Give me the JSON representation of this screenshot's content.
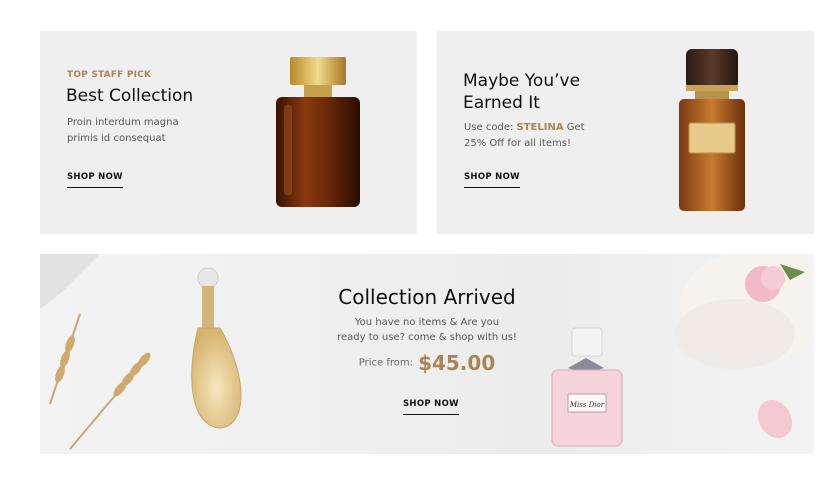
{
  "card1": {
    "eyebrow": "TOP STAFF PICK",
    "title": "Best Collection",
    "desc_line1": "Proin interdum magna",
    "desc_line2": "primis id consequat",
    "cta": "SHOP NOW"
  },
  "card2": {
    "title_line1": "Maybe You’ve",
    "title_line2": "Earned It",
    "code_prefix": "Use code: ",
    "code": "STELINA",
    "code_suffix": " Get",
    "desc_line2": "25% Off for all items!",
    "cta": "SHOP NOW"
  },
  "banner": {
    "title": "Collection Arrived",
    "desc_line1": "You have no items & Are you",
    "desc_line2": "ready to use? come & shop with us!",
    "price_label": "Price from:",
    "price": "$45.00",
    "cta": "SHOP NOW",
    "bottle_label": "Miss Dior"
  },
  "colors": {
    "accent": "#a98455",
    "card_bg": "#efefef",
    "text": "#111111"
  }
}
